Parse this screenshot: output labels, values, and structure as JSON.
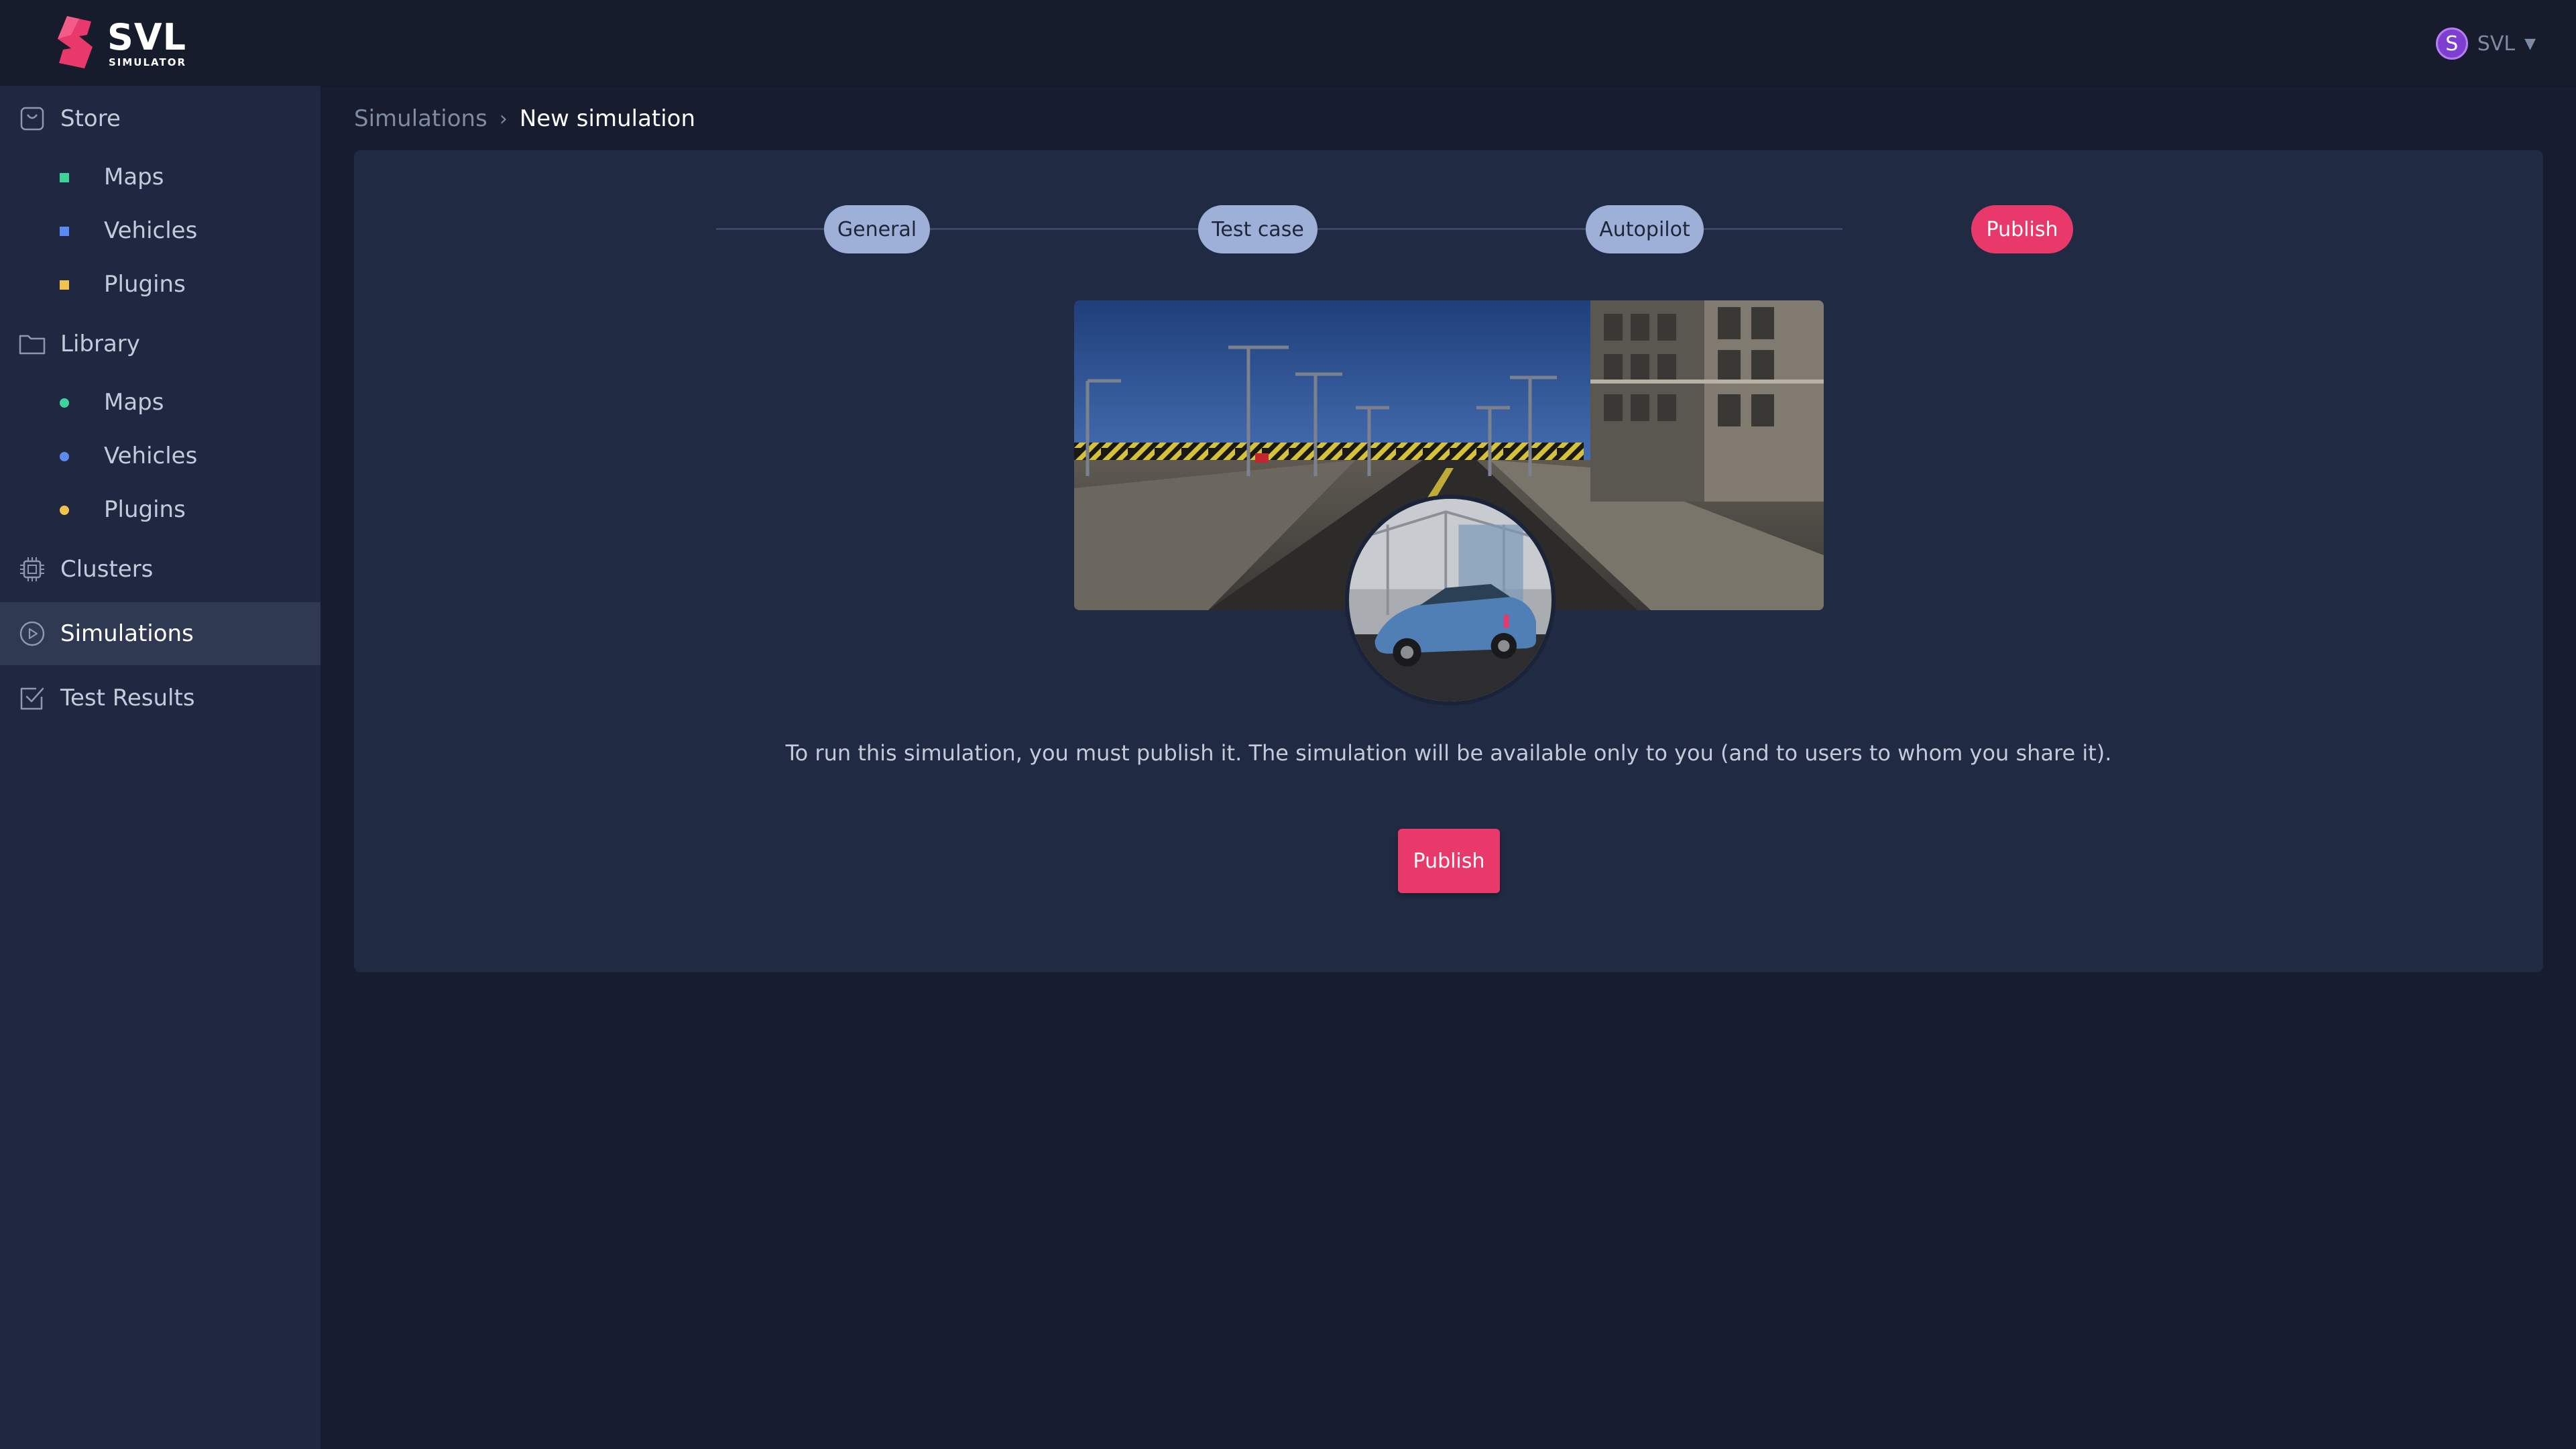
{
  "header": {
    "logo_text": "SVL",
    "logo_subtext": "SIMULATOR",
    "user": {
      "avatar_initial": "S",
      "name": "SVL"
    }
  },
  "sidebar": {
    "store": {
      "label": "Store",
      "items": [
        {
          "label": "Maps",
          "color": "#3fd39b"
        },
        {
          "label": "Vehicles",
          "color": "#5b8bf0"
        },
        {
          "label": "Plugins",
          "color": "#f2c14e"
        }
      ]
    },
    "library": {
      "label": "Library",
      "items": [
        {
          "label": "Maps",
          "color": "#3fd39b"
        },
        {
          "label": "Vehicles",
          "color": "#5b8bf0"
        },
        {
          "label": "Plugins",
          "color": "#f2c14e"
        }
      ]
    },
    "clusters": "Clusters",
    "simulations": "Simulations",
    "test_results": "Test Results"
  },
  "breadcrumb": {
    "parent": "Simulations",
    "separator": "›",
    "current": "New simulation"
  },
  "stepper": {
    "steps": [
      "General",
      "Test case",
      "Autopilot",
      "Publish"
    ],
    "active_step": "Publish"
  },
  "content": {
    "message": "To run this simulation, you must publish it. The simulation will be available only to you (and to users to whom you share it).",
    "publish_button": "Publish"
  },
  "colors": {
    "accent": "#e8396a",
    "step_inactive": "#9eb0d8",
    "sidebar_bg": "#1f2840",
    "panel_bg": "#202a42"
  }
}
